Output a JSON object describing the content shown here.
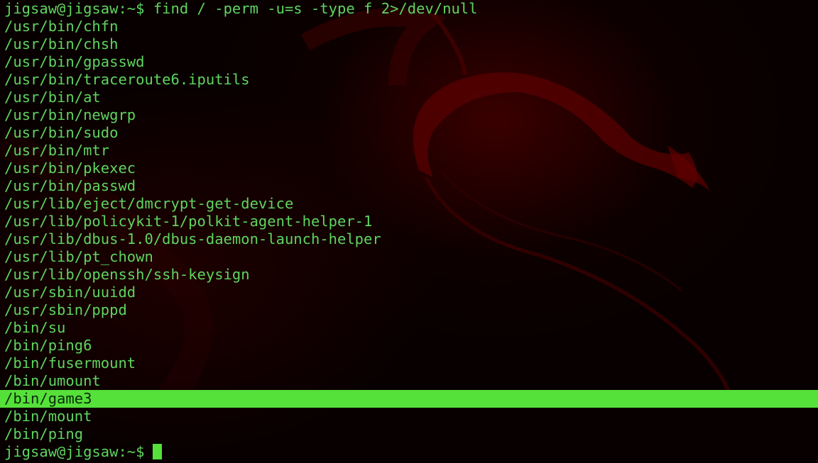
{
  "terminal": {
    "prompt": "jigsaw@jigsaw:~$",
    "command": "find / -perm -u=s -type f 2>/dev/null",
    "output": [
      "/usr/bin/chfn",
      "/usr/bin/chsh",
      "/usr/bin/gpasswd",
      "/usr/bin/traceroute6.iputils",
      "/usr/bin/at",
      "/usr/bin/newgrp",
      "/usr/bin/sudo",
      "/usr/bin/mtr",
      "/usr/bin/pkexec",
      "/usr/bin/passwd",
      "/usr/lib/eject/dmcrypt-get-device",
      "/usr/lib/policykit-1/polkit-agent-helper-1",
      "/usr/lib/dbus-1.0/dbus-daemon-launch-helper",
      "/usr/lib/pt_chown",
      "/usr/lib/openssh/ssh-keysign",
      "/usr/sbin/uuidd",
      "/usr/sbin/pppd",
      "/bin/su",
      "/bin/ping6",
      "/bin/fusermount",
      "/bin/umount",
      "/bin/game3",
      "/bin/mount",
      "/bin/ping"
    ],
    "highlighted_line": "/bin/game3",
    "colors": {
      "text": "#5fd45f",
      "highlight": "#55e03a",
      "background": "#080000",
      "wallpaper_accent": "#6a0000"
    }
  },
  "wallpaper": {
    "icon": "kali-dragon-icon"
  }
}
